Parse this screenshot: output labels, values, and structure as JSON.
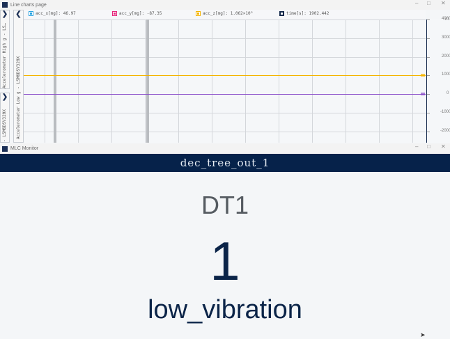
{
  "top_window": {
    "title": "Line charts page",
    "controls": [
      "–",
      "□",
      "✕"
    ]
  },
  "side_panels": [
    {
      "label": "Accelerometer High g - LS…"
    },
    {
      "label": "- LSM6DSV320X"
    }
  ],
  "chart_panel": {
    "label": "Accelerometer Low g - LSM6DSV320X",
    "axis_unit": "m"
  },
  "legend": [
    {
      "label": "acc_x[mg]: 46.97",
      "color": "#29a3e0"
    },
    {
      "label": "acc_y[mg]: -87.35",
      "color": "#e5247a"
    },
    {
      "label": "acc_z[mg]: 1.062×10³",
      "color": "#f5b400"
    },
    {
      "label": "time[s]: 1902.442",
      "color": "#13294b"
    }
  ],
  "chart_data": {
    "type": "line",
    "y_ticks": [
      "4000",
      "3000",
      "2000",
      "1000",
      "0",
      "-1000",
      "-2000"
    ],
    "ylim": [
      -2600,
      4000
    ],
    "series": [
      {
        "name": "acc_z[mg]",
        "color": "#f5b400",
        "value": 1000
      },
      {
        "name": "acc_x/acc_y[mg]",
        "color": "#8a4fc9",
        "value": 0
      }
    ]
  },
  "bottom_window": {
    "title": "MLC Monitor",
    "controls": [
      "–",
      "□",
      "✕"
    ]
  },
  "mlc": {
    "register": "dec_tree_out_1",
    "tree": "DT1",
    "value": "1",
    "class": "low_vibration"
  }
}
